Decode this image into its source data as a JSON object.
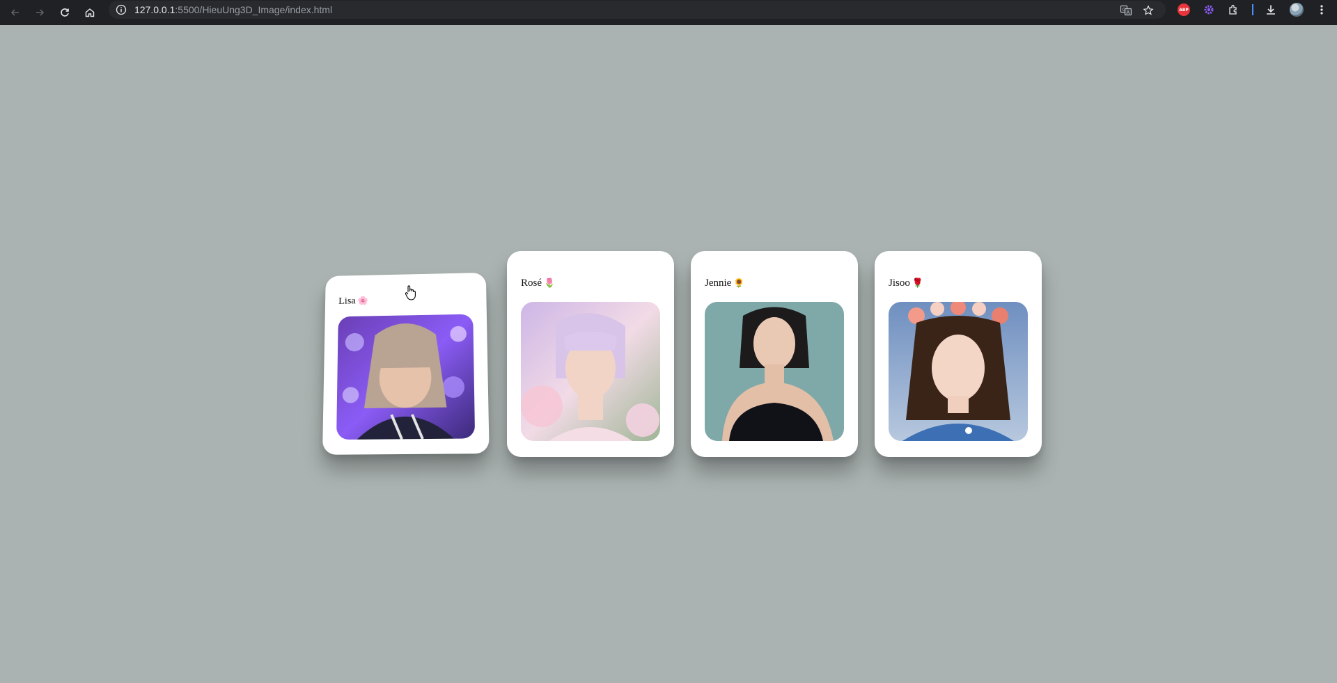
{
  "browser": {
    "url_host": "127.0.0.1",
    "url_path": ":5500/HieuUng3D_Image/index.html",
    "icons": [
      "back-icon",
      "forward-icon",
      "reload-icon",
      "home-icon",
      "info-icon",
      "translate-icon",
      "bookmark-star-icon",
      "adblock-icon",
      "extension-gear-icon",
      "extensions-puzzle-icon",
      "download-icon",
      "profile-avatar-icon",
      "menu-kebab-icon"
    ],
    "abp_label": "ABP"
  },
  "cards": [
    {
      "name": "Lisa",
      "emoji": "🌸"
    },
    {
      "name": "Rosé",
      "emoji": "🌷"
    },
    {
      "name": "Jennie",
      "emoji": "🌻"
    },
    {
      "name": "Jisoo",
      "emoji": "🌹"
    }
  ],
  "colors": {
    "page_background": "#aab3b1",
    "card_background": "#ffffff",
    "chrome_background": "#202124"
  }
}
